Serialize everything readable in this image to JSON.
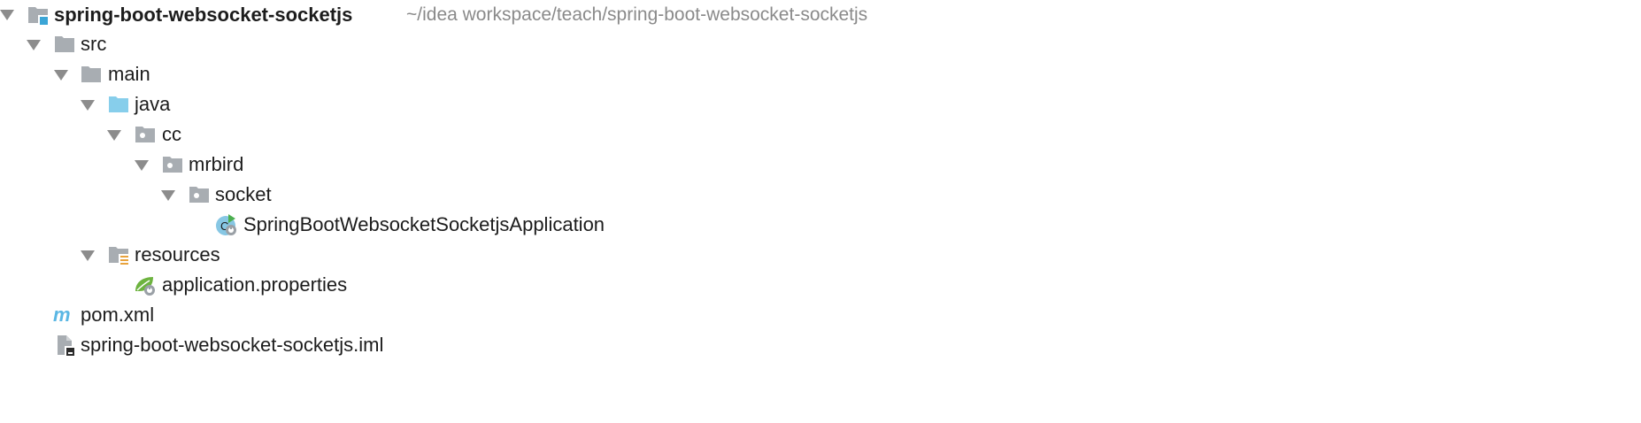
{
  "project_tree": {
    "root": {
      "name": "spring-boot-websocket-socketjs",
      "path": "~/idea workspace/teach/spring-boot-websocket-socketjs",
      "icon": "module-folder-icon"
    },
    "nodes": [
      {
        "name": "src",
        "icon": "folder-icon",
        "expanded": true
      },
      {
        "name": "main",
        "icon": "folder-icon",
        "expanded": true
      },
      {
        "name": "java",
        "icon": "source-folder-icon",
        "expanded": true
      },
      {
        "name": "cc",
        "icon": "package-icon",
        "expanded": true
      },
      {
        "name": "mrbird",
        "icon": "package-icon",
        "expanded": true
      },
      {
        "name": "socket",
        "icon": "package-icon",
        "expanded": true
      },
      {
        "name": "SpringBootWebsocketSocketjsApplication",
        "icon": "spring-boot-class-icon"
      },
      {
        "name": "resources",
        "icon": "resources-folder-icon",
        "expanded": true
      },
      {
        "name": "application.properties",
        "icon": "spring-properties-icon"
      },
      {
        "name": "pom.xml",
        "icon": "maven-icon"
      },
      {
        "name": "spring-boot-websocket-socketjs.iml",
        "icon": "iml-file-icon"
      }
    ]
  },
  "colors": {
    "folder_gray": "#a8adb2",
    "source_folder_blue": "#87ceeb",
    "module_accent": "#3ba5d6",
    "arrow_gray": "#8c8c8c",
    "path_gray": "#8a8a8a",
    "maven_blue": "#5ab7e4",
    "spring_green": "#6db33f",
    "resources_orange": "#e8a33d"
  }
}
